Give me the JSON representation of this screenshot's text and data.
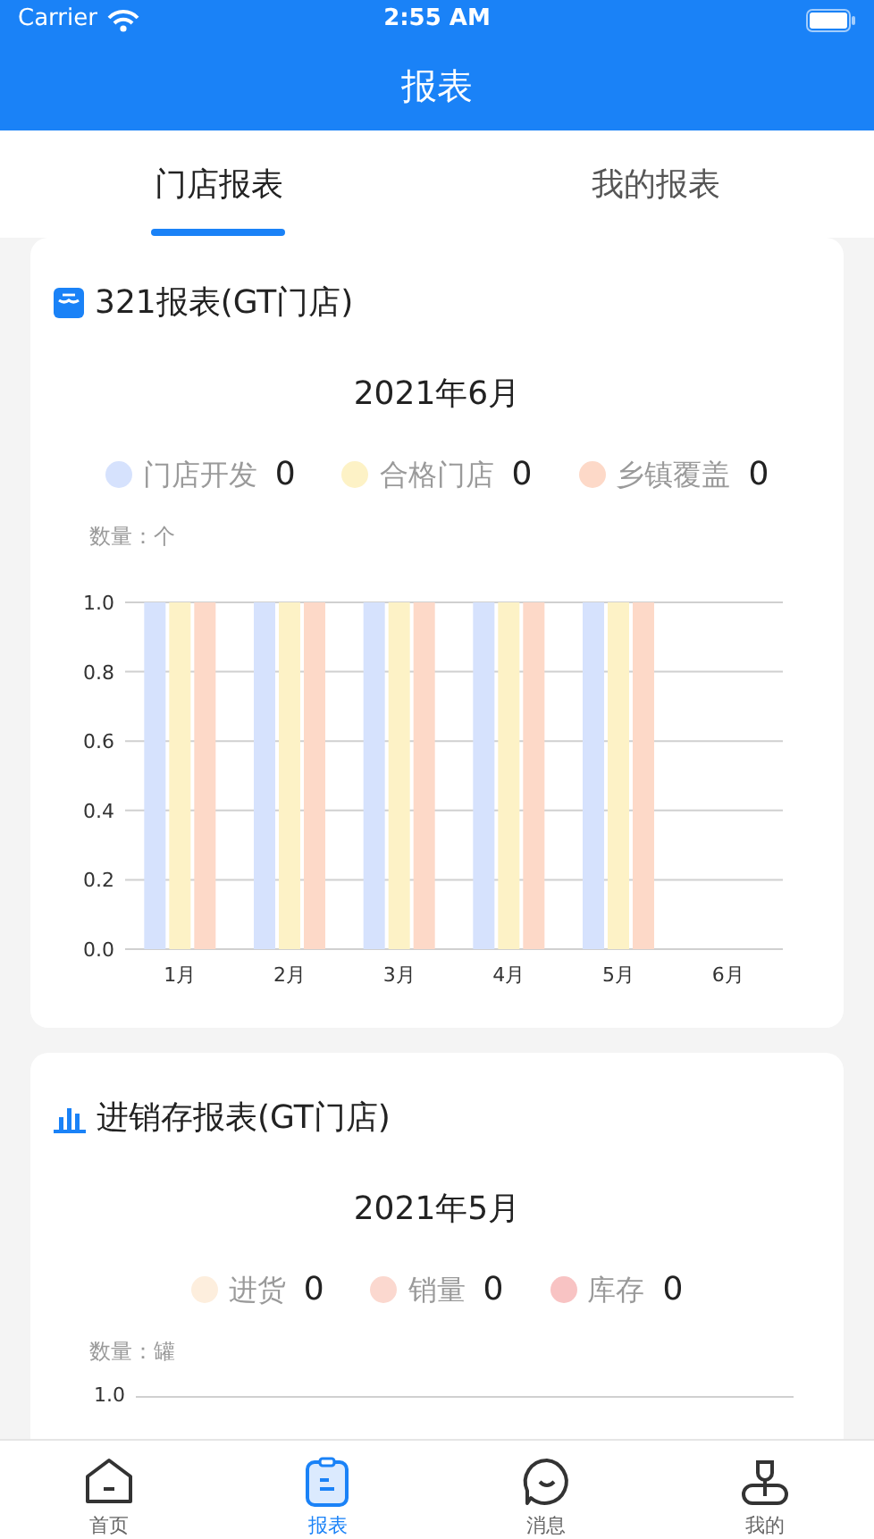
{
  "status_bar": {
    "carrier": "Carrier",
    "time": "2:55 AM"
  },
  "nav_bar": {
    "title": "报表"
  },
  "tabs": [
    {
      "label": "门店报表",
      "selected": true
    },
    {
      "label": "我的报表",
      "selected": false
    }
  ],
  "cards": [
    {
      "kind": "bars",
      "title": "321报表(GT门店)",
      "period": "2021年6月",
      "totals": [
        "0",
        "0",
        "0"
      ],
      "unit": "数量：个",
      "chart_data": {
        "type": "bar",
        "categories": [
          "1月",
          "2月",
          "3月",
          "4月",
          "5月",
          "6月"
        ],
        "ylim": [
          0,
          1
        ],
        "yticks": [
          {
            "value": 0,
            "label": "0.0"
          },
          {
            "value": 0.2,
            "label": "0.2"
          },
          {
            "value": 0.4,
            "label": "0.4"
          },
          {
            "value": 0.6,
            "label": "0.6"
          },
          {
            "value": 0.8,
            "label": "0.8"
          },
          {
            "value": 1,
            "label": "1.0"
          }
        ],
        "grid": true,
        "series": [
          {
            "name": "门店开发",
            "color": "#d6e2fd",
            "values": [
              1,
              1,
              1,
              1,
              1,
              0
            ]
          },
          {
            "name": "合格门店",
            "color": "#fdf2c6",
            "values": [
              1,
              1,
              1,
              1,
              1,
              0
            ]
          },
          {
            "name": "乡镇覆盖",
            "color": "#fdd9c8",
            "values": [
              1,
              1,
              1,
              1,
              1,
              0
            ]
          }
        ]
      }
    },
    {
      "kind": "stock",
      "title": "进销存报表(GT门店)",
      "period": "2021年5月",
      "legend": [
        {
          "label": "进货",
          "value": "0",
          "color": "#fdeedd"
        },
        {
          "label": "销量",
          "value": "0",
          "color": "#fbd8cf"
        },
        {
          "label": "库存",
          "value": "0",
          "color": "#f8c3c3"
        }
      ],
      "unit": "数量：罐",
      "top_tick": "1.0"
    }
  ],
  "tab_bar": [
    {
      "label": "首页",
      "selected": false
    },
    {
      "label": "报表",
      "selected": true
    },
    {
      "label": "消息",
      "selected": false
    },
    {
      "label": "我的",
      "selected": false
    }
  ]
}
